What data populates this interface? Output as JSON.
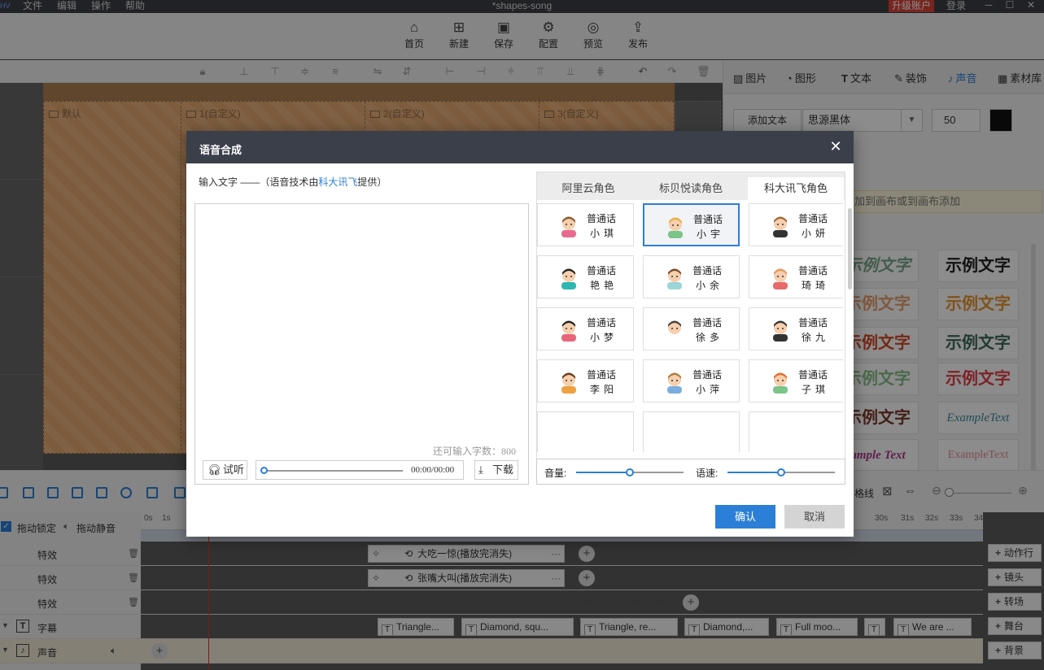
{
  "titlebar": {
    "logo": "HV",
    "menus": [
      "文件",
      "编辑",
      "操作",
      "帮助"
    ],
    "title": "*shapes-song",
    "upgrade": "升级账户",
    "login": "登录"
  },
  "toolbar": {
    "items": [
      {
        "label": "首页",
        "icon": "home-icon"
      },
      {
        "label": "新建",
        "icon": "new-icon"
      },
      {
        "label": "保存",
        "icon": "save-icon"
      },
      {
        "label": "配置",
        "icon": "config-icon"
      },
      {
        "label": "预览",
        "icon": "preview-icon"
      },
      {
        "label": "发布",
        "icon": "publish-icon"
      }
    ]
  },
  "canvas": {
    "scenes": [
      "默认",
      "1(自定义)",
      "2(自定义)",
      "3(自定义)"
    ]
  },
  "rightpanel": {
    "tabs": [
      {
        "label": "图片",
        "icon": "image-icon"
      },
      {
        "label": "图形",
        "icon": "shape-icon"
      },
      {
        "label": "文本",
        "icon": "text-icon"
      },
      {
        "label": "装饰",
        "icon": "decoration-icon"
      },
      {
        "label": "声音",
        "icon": "sound-icon"
      },
      {
        "label": "素材库",
        "icon": "library-icon"
      }
    ],
    "active_tab": "声音",
    "add_text": "添加文本",
    "font": "思源黑体",
    "font_size": "50",
    "text_color": "#111111",
    "hint": "加到画布或到画布添加",
    "samples": [
      "示例文字",
      "示例文字",
      "示例文字",
      "示例文字",
      "示例文字",
      "示例文字",
      "示例文字",
      "示例文字",
      "示例文字",
      "ExampleText",
      "ample Text",
      "ExampleText"
    ]
  },
  "timeline": {
    "lock_label": "拖动锁定",
    "mute_label": "拖动静音",
    "ruler": [
      "0s",
      "1s",
      "30s",
      "31s",
      "32s",
      "33s",
      "34"
    ],
    "rows": [
      {
        "name": "特效",
        "clip": "大吃一惊(播放完消失)"
      },
      {
        "name": "特效",
        "clip": "张嘴大叫(播放完消失)"
      },
      {
        "name": "特效",
        "clip": ""
      },
      {
        "name": "字幕",
        "clip": ""
      },
      {
        "name": "声音",
        "clip": ""
      }
    ],
    "subtitle_clips": [
      "Triangle...",
      "Diamond, squ...",
      "Triangle, re...",
      "Diamond,...",
      "Full moo...",
      "",
      "We are ..."
    ],
    "side_buttons": [
      "动作行",
      "镜头",
      "转场",
      "舞台",
      "背景"
    ],
    "guide_label": "格线"
  },
  "dialog": {
    "title": "语音合成",
    "close": "✕",
    "desc_prefix": "输入文字 ——（语音技术由",
    "desc_link": "科大讯飞",
    "desc_suffix": "提供）",
    "text_value": "",
    "count_label": "还可输入字数：",
    "count_value": "800",
    "listen": "试听",
    "time": "00:00/00:00",
    "download": "下载",
    "voice_tabs": [
      "阿里云角色",
      "标贝悦读角色",
      "科大讯飞角色"
    ],
    "active_voice_tab": "科大讯飞角色",
    "voices": [
      {
        "lang": "普通话",
        "name": "小琪",
        "selected": false,
        "hair": "#8a5a2b",
        "skin": "#f6cfae",
        "shirt": "#e86a8f"
      },
      {
        "lang": "普通话",
        "name": "小宇",
        "selected": true,
        "hair": "#e9b040",
        "skin": "#f6cfae",
        "shirt": "#7bc48a"
      },
      {
        "lang": "普通话",
        "name": "小妍",
        "selected": false,
        "hair": "#a06a3a",
        "skin": "#f6cfae",
        "shirt": "#333333"
      },
      {
        "lang": "普通话",
        "name": "艳艳",
        "selected": false,
        "hair": "#222222",
        "skin": "#f6cfae",
        "shirt": "#2cb7b0"
      },
      {
        "lang": "普通话",
        "name": "小余",
        "selected": false,
        "hair": "#7a4a25",
        "skin": "#f6cfae",
        "shirt": "#9ad5d8"
      },
      {
        "lang": "普通话",
        "name": "琦琦",
        "selected": false,
        "hair": "#e9935a",
        "skin": "#f6cfae",
        "shirt": "#e86a6a"
      },
      {
        "lang": "普通话",
        "name": "小梦",
        "selected": false,
        "hair": "#222222",
        "skin": "#f6cfae",
        "shirt": "#e8647a"
      },
      {
        "lang": "普通话",
        "name": "徐多",
        "selected": false,
        "hair": "#444444",
        "skin": "#f6cfae",
        "shirt": "#ffffff"
      },
      {
        "lang": "普通话",
        "name": "徐九",
        "selected": false,
        "hair": "#333333",
        "skin": "#f6cfae",
        "shirt": "#333333"
      },
      {
        "lang": "普通话",
        "name": "李阳",
        "selected": false,
        "hair": "#6b3a1a",
        "skin": "#f6cfae",
        "shirt": "#f0a040"
      },
      {
        "lang": "普通话",
        "name": "小萍",
        "selected": false,
        "hair": "#b07a3a",
        "skin": "#f6cfae",
        "shirt": "#7aaee0"
      },
      {
        "lang": "普通话",
        "name": "子琪",
        "selected": false,
        "hair": "#e96a2a",
        "skin": "#f6cfae",
        "shirt": "#7bc48a"
      }
    ],
    "volume_label": "音量:",
    "volume": 0.5,
    "speed_label": "语速:",
    "speed": 0.5,
    "ok": "确认",
    "cancel": "取消"
  }
}
